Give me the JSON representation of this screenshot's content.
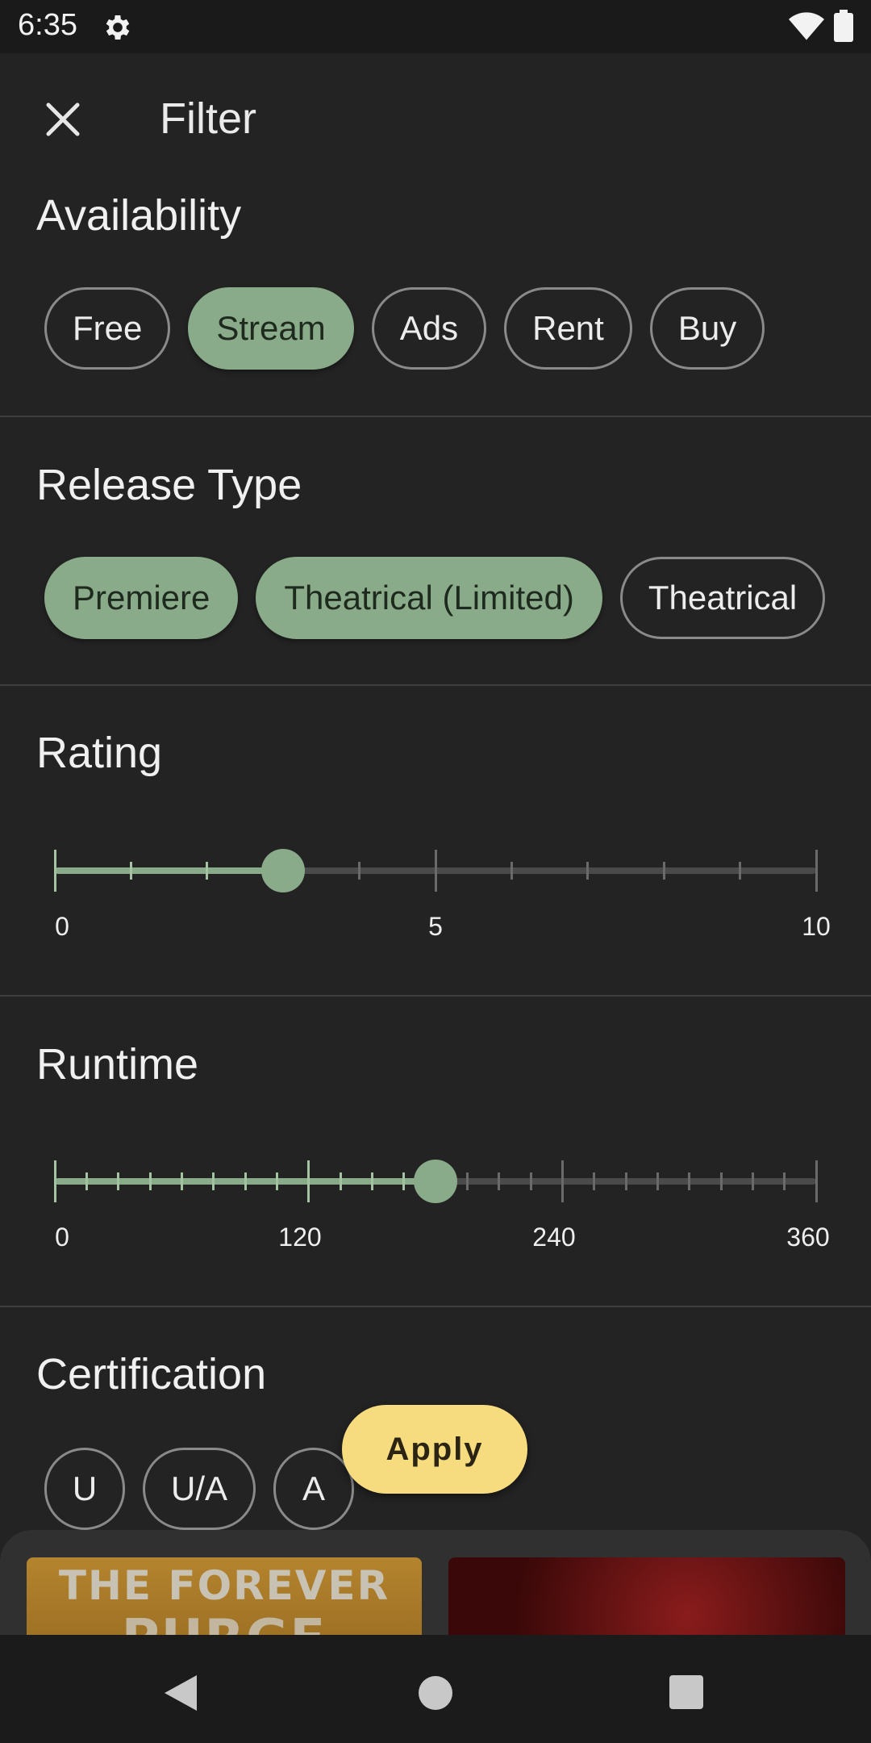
{
  "status_bar": {
    "time": "6:35"
  },
  "header": {
    "title": "Filter"
  },
  "sections": {
    "availability": {
      "title": "Availability",
      "chips": [
        {
          "label": "Free",
          "selected": false
        },
        {
          "label": "Stream",
          "selected": true
        },
        {
          "label": "Ads",
          "selected": false
        },
        {
          "label": "Rent",
          "selected": false
        },
        {
          "label": "Buy",
          "selected": false
        }
      ]
    },
    "release_type": {
      "title": "Release Type",
      "chips": [
        {
          "label": "Premiere",
          "selected": true
        },
        {
          "label": "Theatrical (Limited)",
          "selected": true
        },
        {
          "label": "Theatrical",
          "selected": false
        }
      ]
    },
    "rating": {
      "title": "Rating",
      "min": 0,
      "max": 10,
      "value": 3,
      "labels": [
        "0",
        "5",
        "10"
      ]
    },
    "runtime": {
      "title": "Runtime",
      "min": 0,
      "max": 360,
      "value": 180,
      "labels": [
        "0",
        "120",
        "240",
        "360"
      ]
    },
    "certification": {
      "title": "Certification",
      "chips": [
        {
          "label": "U",
          "selected": false
        },
        {
          "label": "U/A",
          "selected": false
        },
        {
          "label": "A",
          "selected": false
        }
      ]
    }
  },
  "apply_button": {
    "label": "Apply"
  },
  "posters": [
    {
      "text": "THE FOREVER"
    },
    {
      "text": ""
    }
  ]
}
